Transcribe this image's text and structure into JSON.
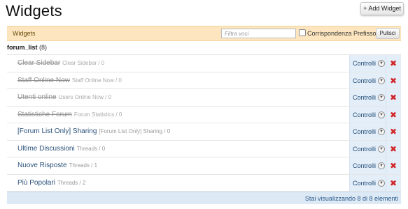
{
  "header": {
    "title": "Widgets",
    "add_button": "+ Add Widget"
  },
  "filter": {
    "label": "Widgets",
    "placeholder": "Filtra voci",
    "checkbox_label": "Corrispondenza Prefisso",
    "clear_button": "Pulisci"
  },
  "group": {
    "name": "forum_list",
    "count": "(8)"
  },
  "rows": [
    {
      "name": "Clear Sidebar",
      "desc": "Clear Sidebar / 0",
      "controls": "Controlli",
      "disabled": true
    },
    {
      "name": "Staff Online Now",
      "desc": "Staff Online Now / 0",
      "controls": "Controlli",
      "disabled": true
    },
    {
      "name": "Utenti online",
      "desc": "Users Online Now / 0",
      "controls": "Controlli",
      "disabled": true
    },
    {
      "name": "Statistiche Forum",
      "desc": "Forum Statistics / 0",
      "controls": "Controlli",
      "disabled": true
    },
    {
      "name": "[Forum List Only] Sharing",
      "desc": "[Forum List Only] Sharing / 0",
      "controls": "Controlli",
      "disabled": false
    },
    {
      "name": "Ultime Discussioni",
      "desc": "Threads / 0",
      "controls": "Controlli",
      "disabled": false
    },
    {
      "name": "Nuove Risposte",
      "desc": "Threads / 1",
      "controls": "Controlli",
      "disabled": false
    },
    {
      "name": "Più Popolari",
      "desc": "Threads / 2",
      "controls": "Controlli",
      "disabled": false
    }
  ],
  "footer": {
    "status": "Stai visualizzando 8 di 8 elementi"
  },
  "icons": {
    "controls_menu": "chevron-down-icon",
    "delete": "delete-x-icon"
  },
  "colors": {
    "filter_bar": "#fde6bf",
    "link": "#2a5078",
    "delete": "#d0262a",
    "controls_bg": "#e3eef9"
  }
}
